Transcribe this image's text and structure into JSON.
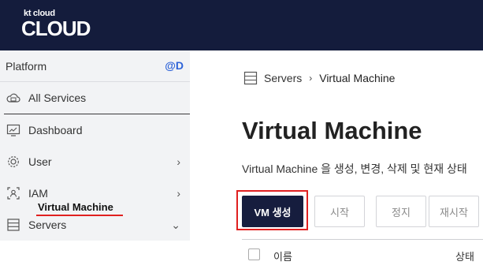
{
  "brand": {
    "top": "kt cloud",
    "bottom": "CLOUD"
  },
  "sidebar": {
    "header": {
      "label": "Platform",
      "badge": "@D"
    },
    "items": [
      {
        "label": "All Services",
        "icon": "cloud-icon",
        "chevron": ""
      },
      {
        "label": "Dashboard",
        "icon": "dashboard-icon",
        "chevron": ""
      },
      {
        "label": "User",
        "icon": "gear-icon",
        "chevron": "›"
      },
      {
        "label": "IAM",
        "icon": "iam-icon",
        "chevron": "›"
      },
      {
        "label": "Servers",
        "icon": "server-icon",
        "chevron": "⌄"
      }
    ],
    "active_subitem": "Virtual Machine"
  },
  "breadcrumb": {
    "root": "Servers",
    "separator": "›",
    "current": "Virtual Machine"
  },
  "page": {
    "title": "Virtual Machine",
    "description": "Virtual Machine 을 생성, 변경, 삭제 및 현재 상태"
  },
  "toolbar": {
    "create": "VM 생성",
    "start": "시작",
    "stop": "정지",
    "restart": "재시작"
  },
  "table": {
    "columns": [
      "이름",
      "상태"
    ]
  },
  "colors": {
    "topbar": "#141c3c",
    "primary_button": "#161d3e",
    "highlight": "#e02020",
    "badge": "#2e63d8"
  }
}
